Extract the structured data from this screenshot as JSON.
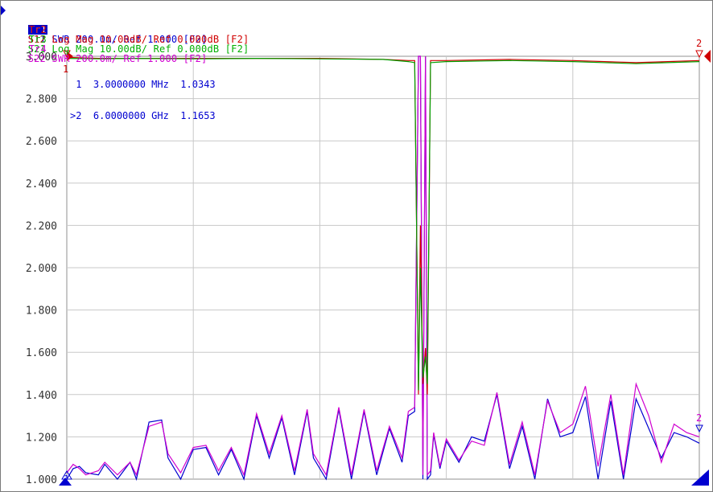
{
  "traces": [
    {
      "tag": "Tr1",
      "label": "S11 SWR 200.0m/ Ref 1.000 [F2]",
      "color": "#0000d0",
      "active": true
    },
    {
      "tag": "Tr2",
      "label": "S12 Log Mag 10.00dB/ Ref 0.000dB [F2]",
      "color": "#d00000",
      "active": false
    },
    {
      "tag": "Tr3",
      "label": "S21 Log Mag 10.00dB/ Ref 0.000dB [F2]",
      "color": "#00c000",
      "active": false
    },
    {
      "tag": "Tr4",
      "label": "S22 SWR 200.0m/ Ref 1.000 [F2]",
      "color": "#d000d0",
      "active": false
    }
  ],
  "markers": [
    {
      "id": "1",
      "prefix": " ",
      "freq": "3.0000000 MHz",
      "value": "1.0343"
    },
    {
      "id": "2",
      "prefix": ">",
      "freq": "6.0000000 GHz",
      "value": "1.1653"
    }
  ],
  "chart_data": {
    "type": "line",
    "ylim": [
      1.0,
      3.0
    ],
    "yticks": [
      "3.000",
      "2.800",
      "2.600",
      "2.400",
      "2.200",
      "2.000",
      "1.800",
      "1.600",
      "1.400",
      "1.200",
      "1.000"
    ],
    "xlim": [
      0,
      1
    ],
    "grid": true,
    "series": [
      {
        "name": "S11",
        "color": "#0000d0",
        "x": [
          0,
          0.01,
          0.02,
          0.03,
          0.05,
          0.06,
          0.08,
          0.1,
          0.11,
          0.13,
          0.15,
          0.16,
          0.18,
          0.2,
          0.22,
          0.24,
          0.26,
          0.28,
          0.3,
          0.32,
          0.34,
          0.36,
          0.38,
          0.39,
          0.41,
          0.43,
          0.45,
          0.47,
          0.49,
          0.51,
          0.53,
          0.54,
          0.55,
          0.556,
          0.559,
          0.563,
          0.567,
          0.57,
          0.575,
          0.58,
          0.59,
          0.6,
          0.62,
          0.64,
          0.66,
          0.68,
          0.7,
          0.72,
          0.74,
          0.76,
          0.78,
          0.8,
          0.82,
          0.84,
          0.86,
          0.88,
          0.9,
          0.92,
          0.94,
          0.96,
          0.98,
          1.0
        ],
        "y": [
          1.0,
          1.05,
          1.06,
          1.03,
          1.02,
          1.07,
          1.0,
          1.08,
          1.0,
          1.27,
          1.28,
          1.1,
          1.0,
          1.14,
          1.15,
          1.02,
          1.14,
          1.0,
          1.3,
          1.1,
          1.29,
          1.02,
          1.32,
          1.1,
          1.0,
          1.33,
          1.0,
          1.32,
          1.02,
          1.24,
          1.08,
          1.3,
          1.32,
          3.0,
          3.0,
          1.0,
          3.0,
          1.0,
          1.02,
          1.21,
          1.05,
          1.18,
          1.08,
          1.2,
          1.18,
          1.4,
          1.05,
          1.25,
          1.0,
          1.38,
          1.2,
          1.22,
          1.39,
          1.0,
          1.37,
          1.0,
          1.38,
          1.24,
          1.1,
          1.22,
          1.2,
          1.17
        ]
      },
      {
        "name": "S22",
        "color": "#d000d0",
        "x": [
          0,
          0.01,
          0.02,
          0.03,
          0.05,
          0.06,
          0.08,
          0.1,
          0.11,
          0.13,
          0.15,
          0.16,
          0.18,
          0.2,
          0.22,
          0.24,
          0.26,
          0.28,
          0.3,
          0.32,
          0.34,
          0.36,
          0.38,
          0.39,
          0.41,
          0.43,
          0.45,
          0.47,
          0.49,
          0.51,
          0.53,
          0.54,
          0.55,
          0.556,
          0.559,
          0.563,
          0.567,
          0.57,
          0.575,
          0.58,
          0.59,
          0.6,
          0.62,
          0.64,
          0.66,
          0.68,
          0.7,
          0.72,
          0.74,
          0.76,
          0.78,
          0.8,
          0.82,
          0.84,
          0.86,
          0.88,
          0.9,
          0.92,
          0.94,
          0.96,
          0.98,
          1.0
        ],
        "y": [
          1.03,
          1.07,
          1.05,
          1.02,
          1.04,
          1.08,
          1.02,
          1.08,
          1.02,
          1.25,
          1.27,
          1.12,
          1.03,
          1.15,
          1.16,
          1.04,
          1.15,
          1.02,
          1.31,
          1.12,
          1.3,
          1.04,
          1.33,
          1.12,
          1.02,
          1.34,
          1.02,
          1.33,
          1.04,
          1.25,
          1.1,
          1.32,
          1.34,
          3.0,
          3.0,
          1.02,
          3.0,
          1.02,
          1.04,
          1.22,
          1.06,
          1.19,
          1.09,
          1.18,
          1.16,
          1.41,
          1.07,
          1.27,
          1.02,
          1.37,
          1.22,
          1.26,
          1.44,
          1.06,
          1.4,
          1.02,
          1.45,
          1.3,
          1.08,
          1.26,
          1.22,
          1.2
        ]
      },
      {
        "name": "S12",
        "color": "#d00000",
        "x": [
          0,
          0.05,
          0.1,
          0.2,
          0.3,
          0.4,
          0.5,
          0.54,
          0.55,
          0.556,
          0.559,
          0.563,
          0.567,
          0.57,
          0.575,
          0.6,
          0.7,
          0.8,
          0.9,
          0.95,
          1.0
        ],
        "y": [
          2.995,
          2.99,
          2.99,
          2.99,
          2.99,
          2.99,
          2.985,
          2.98,
          2.98,
          1.4,
          2.2,
          1.45,
          1.62,
          1.4,
          2.98,
          2.98,
          2.985,
          2.98,
          2.97,
          2.975,
          2.98
        ]
      },
      {
        "name": "S21",
        "color": "#00a000",
        "x": [
          0,
          0.05,
          0.1,
          0.2,
          0.3,
          0.4,
          0.5,
          0.54,
          0.55,
          0.556,
          0.559,
          0.563,
          0.567,
          0.57,
          0.575,
          0.6,
          0.7,
          0.8,
          0.9,
          0.95,
          1.0
        ],
        "y": [
          2.99,
          2.988,
          2.99,
          2.988,
          2.99,
          2.988,
          2.985,
          2.975,
          2.97,
          1.42,
          2.0,
          1.48,
          1.58,
          1.45,
          2.97,
          2.975,
          2.98,
          2.975,
          2.965,
          2.97,
          2.975
        ]
      }
    ]
  }
}
